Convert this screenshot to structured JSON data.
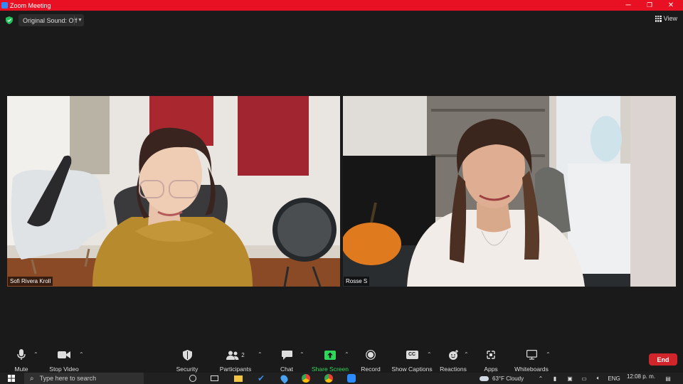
{
  "window": {
    "title": "Zoom Meeting"
  },
  "topbar": {
    "original_sound_label": "Original Sound: Off",
    "view_label": "View"
  },
  "participants": [
    {
      "name": "Sofi Rivera Kroll"
    },
    {
      "name": "Rosse S"
    }
  ],
  "toolbar": {
    "mute": "Mute",
    "stop_video": "Stop Video",
    "security": "Security",
    "participants": "Participants",
    "participants_count": "2",
    "chat": "Chat",
    "share_screen": "Share Screen",
    "record": "Record",
    "show_captions": "Show Captions",
    "captions_badge": "CC",
    "reactions": "Reactions",
    "apps": "Apps",
    "whiteboards": "Whiteboards",
    "end": "End"
  },
  "taskbar": {
    "search_placeholder": "Type here to search",
    "weather": "63°F  Cloudy",
    "language": "ENG",
    "time": "12:08 p. m."
  },
  "colors": {
    "titlebar": "#e81123",
    "share_green": "#2fd85a",
    "end_red": "#d0252a"
  }
}
